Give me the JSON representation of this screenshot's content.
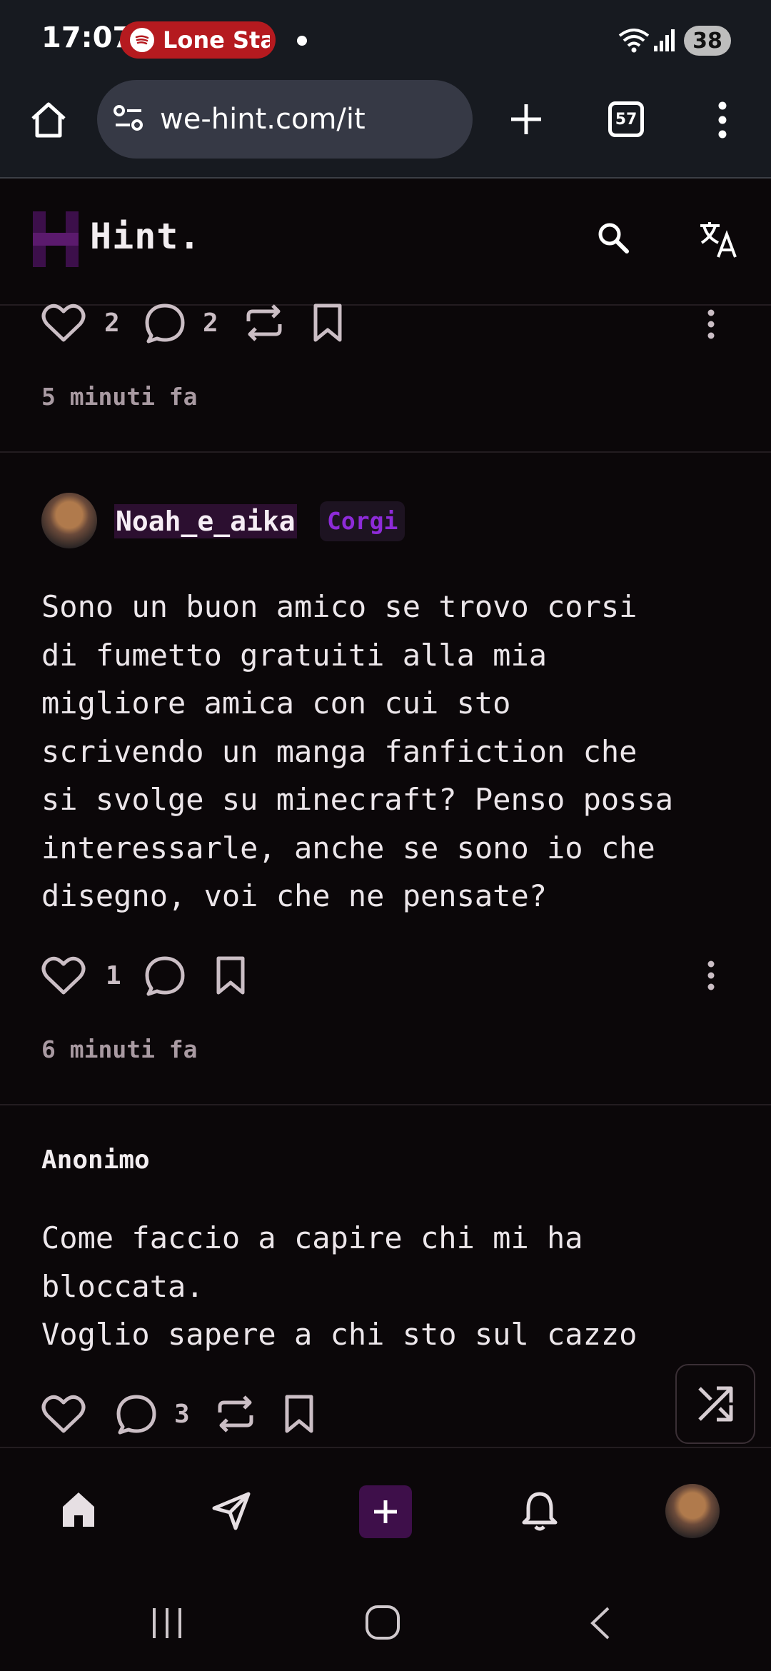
{
  "status_bar": {
    "time": "17:07",
    "spotify_label": "Lone Star",
    "battery": "38"
  },
  "browser": {
    "url": "we-hint.com/it",
    "tab_count": "57"
  },
  "app": {
    "name": "Hint."
  },
  "posts": [
    {
      "likes": "2",
      "comments": "2",
      "time_ago": "5 minuti fa"
    },
    {
      "username": "Noah_e_aika",
      "badge": "Corgi",
      "text": "Sono un buon amico se trovo corsi\ndi fumetto gratuiti alla mia\nmigliore amica con cui sto\nscrivendo un manga fanfiction che\nsi svolge su minecraft? Penso possa\ninteressarle, anche se sono io che\ndisegno, voi che ne pensate?",
      "likes": "1",
      "time_ago": "6 minuti fa"
    },
    {
      "author": "Anonimo",
      "text": "Come faccio a capire chi mi ha\nbloccata.\nVoglio sapere a chi sto sul cazzo",
      "comments": "3"
    }
  ],
  "icons": {
    "status": [
      "spotify-icon",
      "wifi-icon",
      "signal-icon"
    ],
    "browser": [
      "home-icon",
      "site-settings-icon",
      "new-tab-icon",
      "tab-switcher-icon",
      "menu-icon"
    ],
    "header": [
      "logo-icon",
      "search-icon",
      "translate-icon"
    ],
    "post_actions": [
      "heart-icon",
      "comment-icon",
      "repost-icon",
      "bookmark-icon",
      "more-icon"
    ],
    "nav": [
      "home-icon",
      "send-icon",
      "plus-icon",
      "bell-icon",
      "avatar"
    ],
    "system": [
      "recents-icon",
      "home-circle-icon",
      "back-icon"
    ]
  },
  "colors": {
    "accent": "#3e0f4a",
    "badge_text": "#8d2bd8",
    "spotify": "#b51a1f",
    "bg": "#0b0709"
  }
}
